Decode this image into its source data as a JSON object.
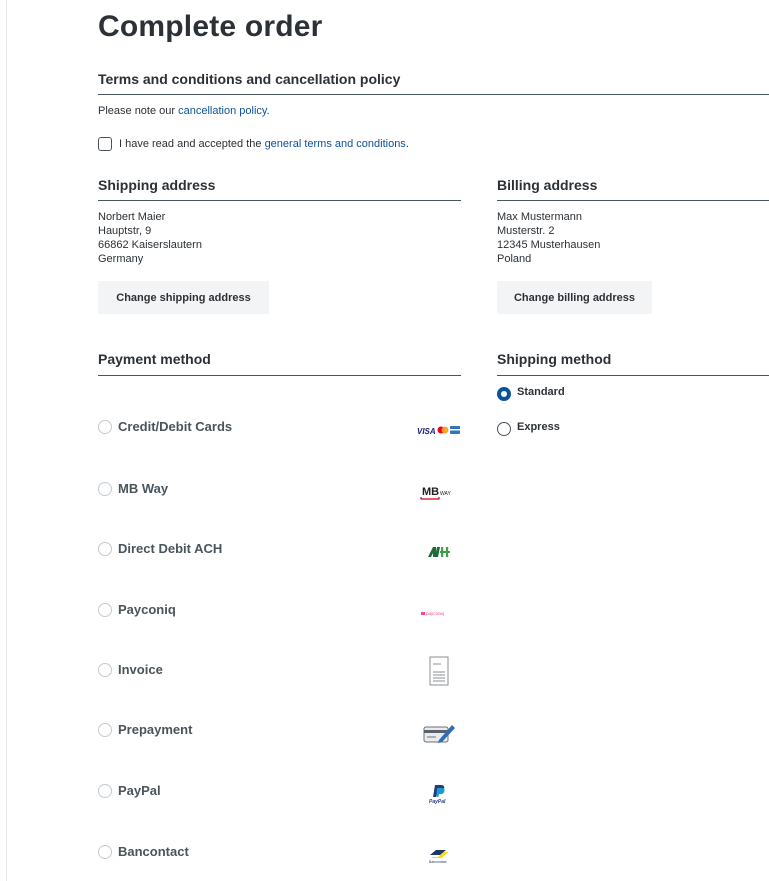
{
  "page_title": "Complete order",
  "terms": {
    "heading": "Terms and conditions and cancellation policy",
    "note_prefix": "Please note our ",
    "note_link": "cancellation policy",
    "note_suffix": ".",
    "checkbox_prefix": "I have read and accepted the ",
    "checkbox_link": "general terms and conditions",
    "checkbox_suffix": ".",
    "checked": false
  },
  "shipping_address": {
    "heading": "Shipping address",
    "lines": [
      "Norbert Maier",
      "Hauptstr, 9",
      "66862 Kaiserslautern",
      "Germany"
    ],
    "button": "Change shipping address"
  },
  "billing_address": {
    "heading": "Billing address",
    "lines": [
      "Max Mustermann",
      "Musterstr. 2",
      "12345 Musterhausen",
      "Poland"
    ],
    "button": "Change billing address"
  },
  "payment": {
    "heading": "Payment method",
    "methods": [
      {
        "label": "Credit/Debit Cards",
        "icon": "credit-cards-logo-icon",
        "logo_text": "VISA"
      },
      {
        "label": "MB Way",
        "icon": "mbway-logo-icon",
        "logo_text": "MB",
        "logo_sub": "WAY"
      },
      {
        "label": "Direct Debit ACH",
        "icon": "ach-logo-icon",
        "logo_text": "ACH"
      },
      {
        "label": "Payconiq",
        "icon": "payconiq-logo-icon",
        "logo_text": "payconiq"
      },
      {
        "label": "Invoice",
        "icon": "invoice-document-icon"
      },
      {
        "label": "Prepayment",
        "icon": "prepayment-card-pen-icon"
      },
      {
        "label": "PayPal",
        "icon": "paypal-logo-icon",
        "logo_text": "PayPal"
      },
      {
        "label": "Bancontact",
        "icon": "bancontact-logo-icon",
        "logo_text": "Bancontact"
      }
    ]
  },
  "shipping_method": {
    "heading": "Shipping method",
    "options": [
      {
        "label": "Standard",
        "selected": true
      },
      {
        "label": "Express",
        "selected": false
      }
    ]
  },
  "colors": {
    "text": "#2b3136",
    "link": "#0b539b",
    "rule": "#4a545b",
    "button_bg": "#f3f4f5",
    "muted_label": "#4a545b"
  }
}
